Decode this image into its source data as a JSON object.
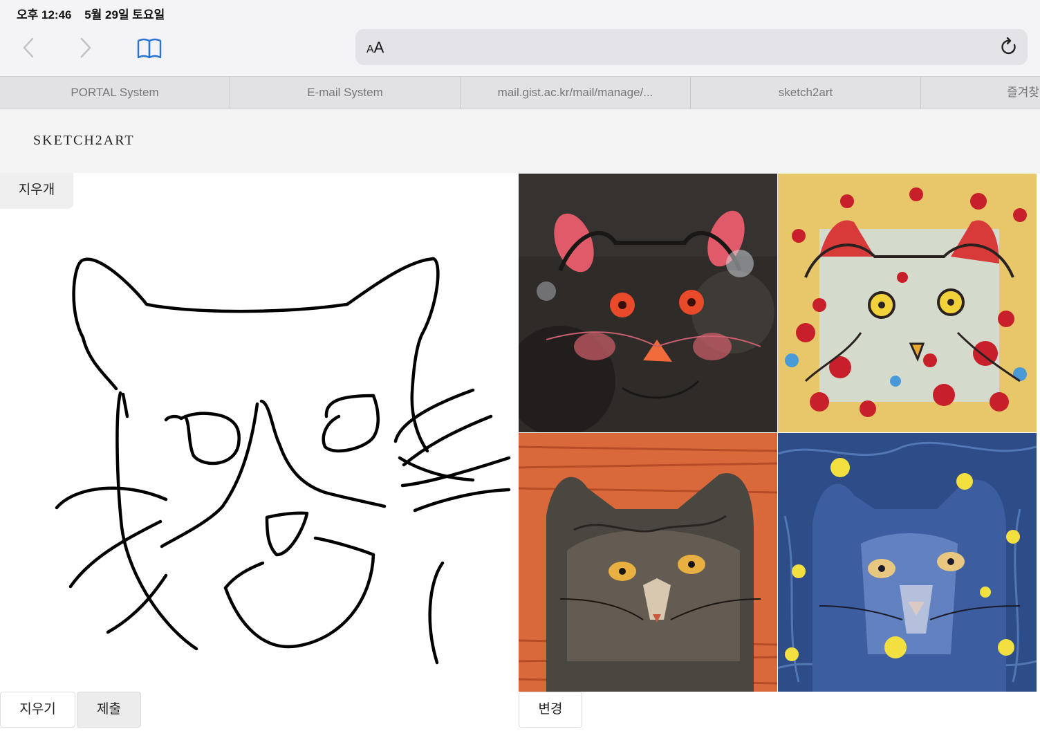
{
  "status": {
    "time": "오후 12:46",
    "date": "5월 29일 토요일"
  },
  "toolbar": {
    "text_size_label_small": "A",
    "text_size_label_large": "A"
  },
  "favorites": [
    {
      "label": "PORTAL System"
    },
    {
      "label": "E-mail System"
    },
    {
      "label": "mail.gist.ac.kr/mail/manage/..."
    },
    {
      "label": "sketch2art"
    },
    {
      "label": "즐겨찾"
    }
  ],
  "page": {
    "brand": "SKETCH2ART",
    "eraser_label": "지우개",
    "erase_all_label": "지우기",
    "submit_label": "제출",
    "change_label": "변경"
  },
  "icons": {
    "back": "chevron-left-icon",
    "forward": "chevron-right-icon",
    "bookmarks": "book-icon",
    "reload": "reload-icon"
  },
  "colors": {
    "link": "#2a74d4",
    "disabled": "#c4c4c8"
  }
}
